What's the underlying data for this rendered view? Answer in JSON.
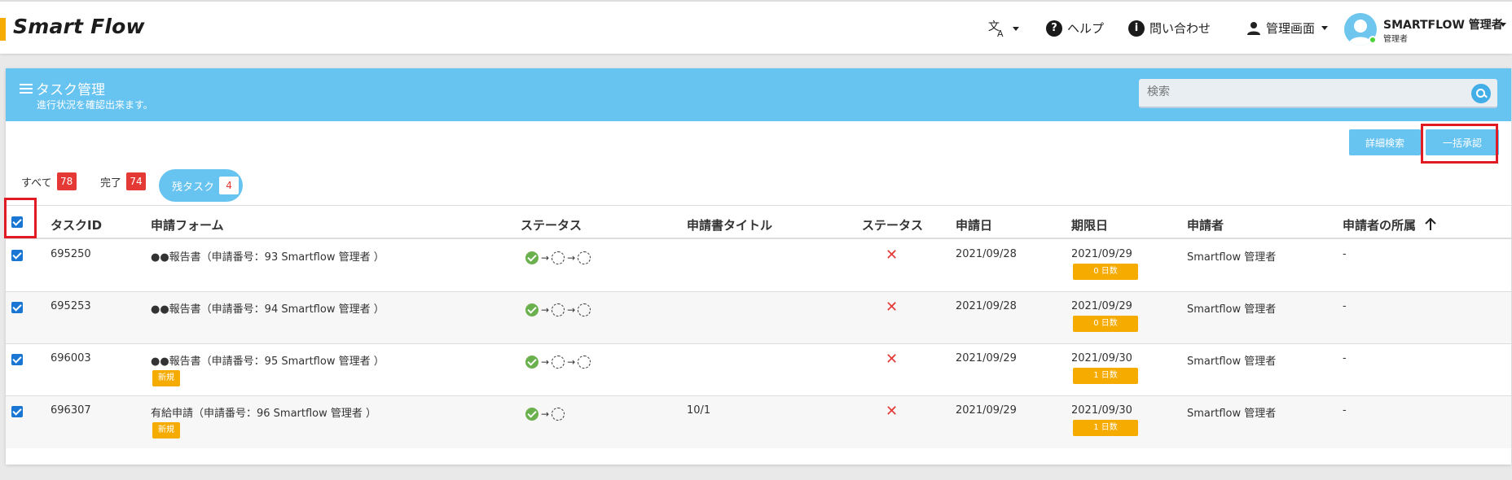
{
  "app": {
    "logo": "Smart Flow"
  },
  "nav": {
    "help_label": "ヘルプ",
    "contact_label": "問い合わせ",
    "admin_label": "管理画面",
    "user_name": "SMARTFLOW 管理者",
    "user_role": "管理者"
  },
  "page": {
    "title": "タスク管理",
    "subtitle": "進行状況を確認出来ます。",
    "search_placeholder": "検索",
    "detail_search_label": "詳細検索",
    "bulk_approve_label": "一括承認"
  },
  "tabs": [
    {
      "label": "すべて",
      "count": "78"
    },
    {
      "label": "完了",
      "count": "74"
    },
    {
      "label": "残タスク",
      "count": "4"
    }
  ],
  "table": {
    "headers": [
      "タスクID",
      "申請フォーム",
      "ステータス",
      "申請書タイトル",
      "ステータス",
      "申請日",
      "期限日",
      "申請者",
      "申請者の所属"
    ],
    "rows": [
      {
        "id": "695250",
        "form": "●●報告書（申請番号：93  Smartflow 管理者 ）",
        "tag": "",
        "title": "",
        "applied": "2021/09/28",
        "due": "2021/09/29",
        "days": "0 日数",
        "applicant": "Smartflow 管理者",
        "dept": "-"
      },
      {
        "id": "695253",
        "form": "●●報告書（申請番号：94  Smartflow 管理者 ）",
        "tag": "",
        "title": "",
        "applied": "2021/09/28",
        "due": "2021/09/29",
        "days": "0 日数",
        "applicant": "Smartflow 管理者",
        "dept": "-"
      },
      {
        "id": "696003",
        "form": "●●報告書（申請番号：95  Smartflow 管理者 ）",
        "tag": "新規",
        "title": "",
        "applied": "2021/09/29",
        "due": "2021/09/30",
        "days": "1 日数",
        "applicant": "Smartflow 管理者",
        "dept": "-"
      },
      {
        "id": "696307",
        "form": "有給申請（申請番号：96  Smartflow 管理者 ）",
        "tag": "新規",
        "title": "10/1",
        "applied": "2021/09/29",
        "due": "2021/09/30",
        "days": "1 日数",
        "applicant": "Smartflow 管理者",
        "dept": "-"
      }
    ]
  },
  "colors": {
    "accent": "#67c3f0",
    "badge_red": "#e53935",
    "tag_orange": "#f6ab00",
    "highlight": "#e01b24"
  }
}
